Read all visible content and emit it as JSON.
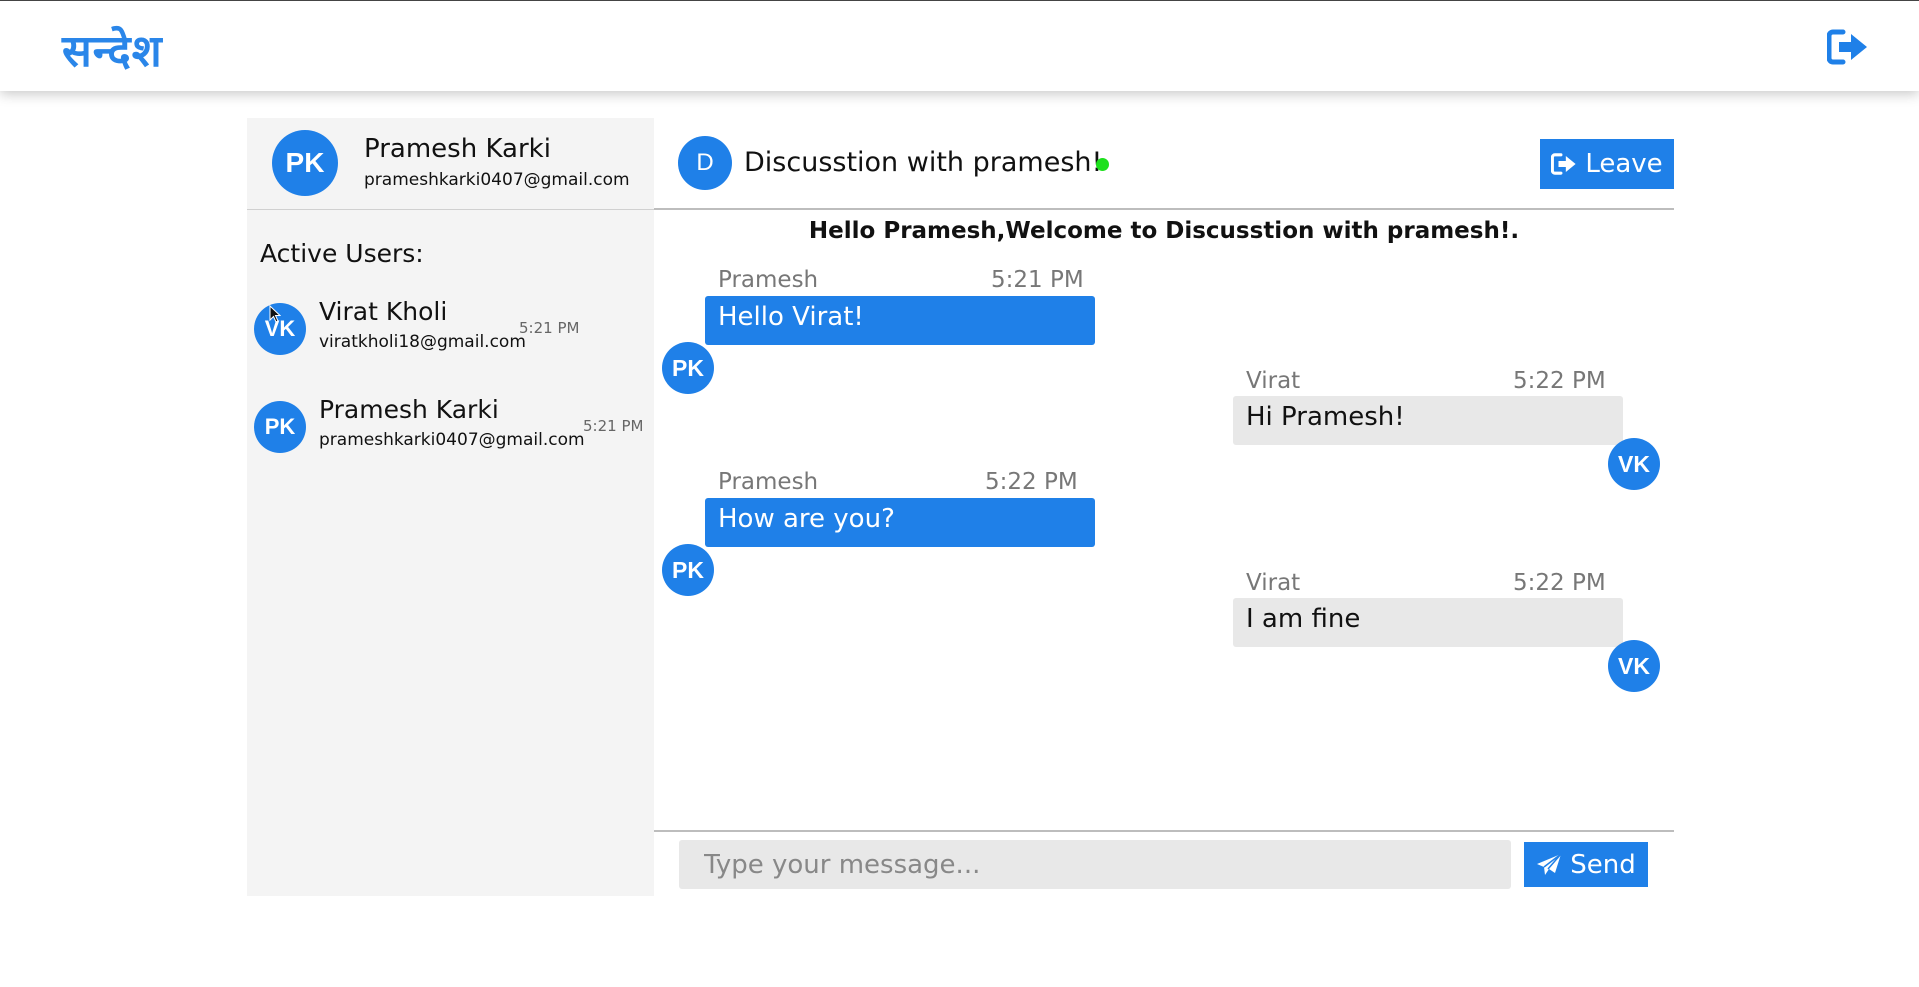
{
  "app": {
    "logo_text": "सन्देश"
  },
  "icons": {
    "logout": "sign-out-icon",
    "leave": "sign-out-icon",
    "send": "paper-plane-icon"
  },
  "colors": {
    "accent": "#1f80e8",
    "online": "#1de01d",
    "sidebar_bg": "#f4f4f4",
    "theirs_bubble": "#e8e8e8"
  },
  "current_user": {
    "initials": "PK",
    "name": "Pramesh Karki",
    "email": "prameshkarki0407@gmail.com"
  },
  "sidebar": {
    "title": "Active Users:",
    "users": [
      {
        "initials": "VK",
        "name": "Virat Kholi",
        "email": "viratkholi18@gmail.com",
        "time": "5:21 PM"
      },
      {
        "initials": "PK",
        "name": "Pramesh Karki",
        "email": "prameshkarki0407@gmail.com",
        "time": "5:21 PM"
      }
    ]
  },
  "room": {
    "initial": "D",
    "name": "Discusstion with pramesh!",
    "leave_label": "Leave",
    "online": true
  },
  "welcome_text": "Hello Pramesh,Welcome to Discusstion with pramesh!.",
  "messages": [
    {
      "sender": "Pramesh",
      "time": "5:21 PM",
      "text": "Hello Virat!",
      "initials": "PK",
      "mine": true
    },
    {
      "sender": "Virat",
      "time": "5:22 PM",
      "text": "Hi Pramesh!",
      "initials": "VK",
      "mine": false
    },
    {
      "sender": "Pramesh",
      "time": "5:22 PM",
      "text": "How are you?",
      "initials": "PK",
      "mine": true
    },
    {
      "sender": "Virat",
      "time": "5:22 PM",
      "text": "I am fine",
      "initials": "VK",
      "mine": false
    }
  ],
  "composer": {
    "placeholder": "Type your message...",
    "value": "",
    "send_label": "Send"
  }
}
